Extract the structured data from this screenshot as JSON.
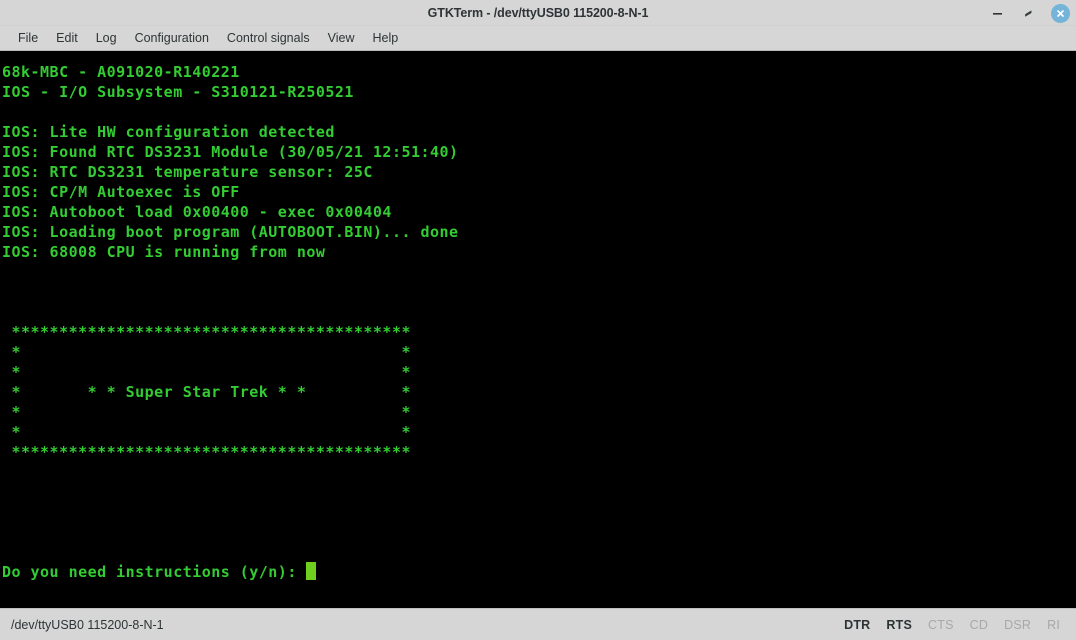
{
  "window": {
    "title": "GTKTerm - /dev/ttyUSB0  115200-8-N-1",
    "minimize_label": "minimize",
    "restore_label": "restore",
    "close_label": "close"
  },
  "menu": {
    "items": [
      {
        "label": "File"
      },
      {
        "label": "Edit"
      },
      {
        "label": "Log"
      },
      {
        "label": "Configuration"
      },
      {
        "label": "Control signals"
      },
      {
        "label": "View"
      },
      {
        "label": "Help"
      }
    ]
  },
  "terminal": {
    "foreground_color": "#33cc33",
    "background_color": "#000000",
    "cursor_color": "#6fcf1e",
    "lines": [
      "68k-MBC - A091020-R140221",
      "IOS - I/O Subsystem - S310121-R250521",
      "",
      "IOS: Lite HW configuration detected",
      "IOS: Found RTC DS3231 Module (30/05/21 12:51:40)",
      "IOS: RTC DS3231 temperature sensor: 25C",
      "IOS: CP/M Autoexec is OFF",
      "IOS: Autoboot load 0x00400 - exec 0x00404",
      "IOS: Loading boot program (AUTOBOOT.BIN)... done",
      "IOS: 68008 CPU is running from now",
      "",
      "",
      "",
      " ******************************************",
      " *                                        *",
      " *                                        *",
      " *       * * Super Star Trek * *          *",
      " *                                        *",
      " *                                        *",
      " ******************************************",
      "",
      "",
      "",
      "",
      "",
      "Do you need instructions (y/n): "
    ],
    "prompt": "Do you need instructions (y/n): ",
    "cursor_visible": true
  },
  "status_bar": {
    "port_info": "/dev/ttyUSB0  115200-8-N-1",
    "signals": [
      {
        "label": "DTR",
        "active": true
      },
      {
        "label": "RTS",
        "active": true
      },
      {
        "label": "CTS",
        "active": false
      },
      {
        "label": "CD",
        "active": false
      },
      {
        "label": "DSR",
        "active": false
      },
      {
        "label": "RI",
        "active": false
      }
    ]
  }
}
